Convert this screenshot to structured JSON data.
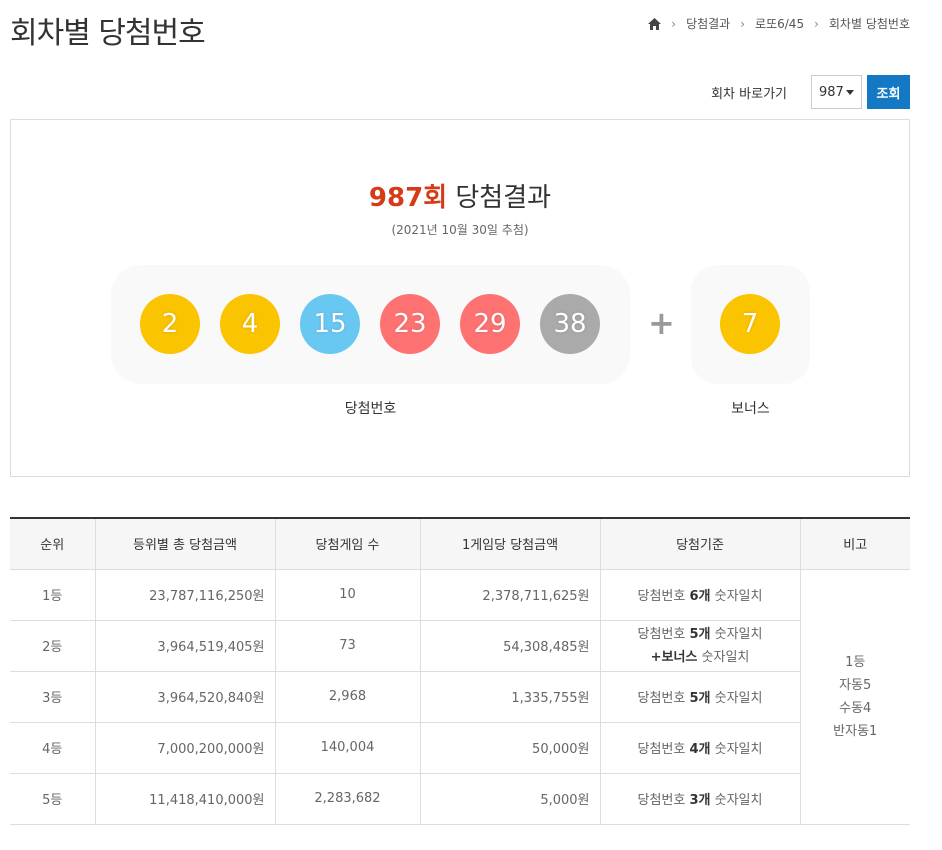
{
  "page": {
    "title": "회차별 당첨번호",
    "breadcrumb": [
      "당첨결과",
      "로또6/45",
      "회차별 당첨번호"
    ]
  },
  "round_nav": {
    "label": "회차 바로가기",
    "selected": "987",
    "search_label": "조회"
  },
  "result": {
    "round": "987회",
    "title_suffix": "당첨결과",
    "date": "(2021년 10월 30일 추첨)",
    "numbers": [
      {
        "value": "2",
        "color": "#fbc400"
      },
      {
        "value": "4",
        "color": "#fbc400"
      },
      {
        "value": "15",
        "color": "#69c8f2"
      },
      {
        "value": "23",
        "color": "#ff7272"
      },
      {
        "value": "29",
        "color": "#ff7272"
      },
      {
        "value": "38",
        "color": "#aaaaaa"
      }
    ],
    "plus": "+",
    "bonus": {
      "value": "7",
      "color": "#fbc400"
    },
    "numbers_label": "당첨번호",
    "bonus_label": "보너스"
  },
  "table": {
    "headers": [
      "순위",
      "등위별 총 당첨금액",
      "당첨게임 수",
      "1게임당 당첨금액",
      "당첨기준",
      "비고"
    ],
    "rows": [
      {
        "rank": "1등",
        "total": "23,787,116,250원",
        "winners": "10",
        "per_game": "2,378,711,625원",
        "criteria_prefix": "당첨번호 ",
        "criteria_bold": "6개",
        "criteria_suffix": " 숫자일치"
      },
      {
        "rank": "2등",
        "total": "3,964,519,405원",
        "winners": "73",
        "per_game": "54,308,485원",
        "criteria_prefix": "당첨번호 ",
        "criteria_bold": "5개",
        "criteria_suffix": " 숫자일치",
        "criteria_line2_bold": "+보너스",
        "criteria_line2_suffix": " 숫자일치"
      },
      {
        "rank": "3등",
        "total": "3,964,520,840원",
        "winners": "2,968",
        "per_game": "1,335,755원",
        "criteria_prefix": "당첨번호 ",
        "criteria_bold": "5개",
        "criteria_suffix": " 숫자일치"
      },
      {
        "rank": "4등",
        "total": "7,000,200,000원",
        "winners": "140,004",
        "per_game": "50,000원",
        "criteria_prefix": "당첨번호 ",
        "criteria_bold": "4개",
        "criteria_suffix": " 숫자일치"
      },
      {
        "rank": "5등",
        "total": "11,418,410,000원",
        "winners": "2,283,682",
        "per_game": "5,000원",
        "criteria_prefix": "당첨번호 ",
        "criteria_bold": "3개",
        "criteria_suffix": " 숫자일치"
      }
    ],
    "note": [
      "1등",
      "자동5",
      "수동4",
      "반자동1"
    ]
  }
}
